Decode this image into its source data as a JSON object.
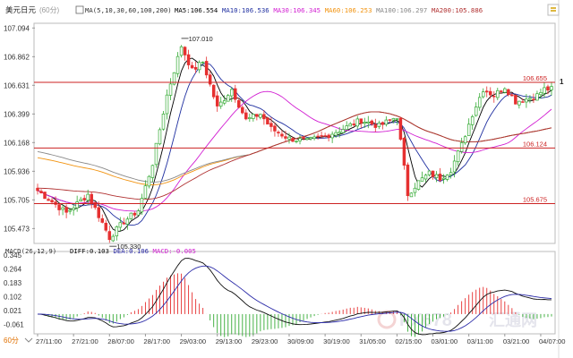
{
  "window": {
    "symbol": "美元日元",
    "period": "(60分)",
    "period_button": "60分",
    "side_marker": "1"
  },
  "watermark": {
    "text": "FX678",
    "cn": "汇通网"
  },
  "colors": {
    "up": "#33aa33",
    "down": "#e63030",
    "ma5": "#000000",
    "ma10": "#1f2fa0",
    "ma30": "#d21fd2",
    "ma60": "#f2930f",
    "ma100": "#888888",
    "ma200": "#b03030",
    "hline": "#cc2222",
    "dif": "#111111",
    "dea": "#2a2aa8",
    "macd_hist_pos": "#e63030",
    "macd_hist_neg": "#33aa33"
  },
  "chart_data": [
    {
      "type": "candlestick",
      "title": "美元日元(60分)",
      "legend_header": "MA(5,10,30,60,100,200)",
      "legend": [
        {
          "name": "MA5",
          "value": "106.554",
          "color_key": "ma5"
        },
        {
          "name": "MA10",
          "value": "106.536",
          "color_key": "ma10"
        },
        {
          "name": "MA30",
          "value": "106.345",
          "color_key": "ma30"
        },
        {
          "name": "MA60",
          "value": "106.253",
          "color_key": "ma60"
        },
        {
          "name": "MA100",
          "value": "106.297",
          "color_key": "ma100"
        },
        {
          "name": "MA200",
          "value": "105.886",
          "color_key": "ma200"
        }
      ],
      "ylim": [
        105.36,
        107.125
      ],
      "y_ticks": [
        "107.094",
        "106.862",
        "106.631",
        "106.399",
        "106.168",
        "105.936",
        "105.705",
        "105.473"
      ],
      "x_ticks": [
        "27/11:00",
        "27/21:00",
        "28/07:00",
        "28/17:00",
        "29/03:00",
        "29/13:00",
        "29/23:00",
        "30/09:00",
        "30/19:00",
        "31/05:00",
        "02/15:00",
        "03/01:00",
        "03/11:00",
        "03/21:00",
        "04/07:00"
      ],
      "x_tick_index": [
        0,
        10,
        20,
        30,
        40,
        50,
        60,
        70,
        80,
        90,
        100,
        110,
        120,
        130,
        140
      ],
      "horizontal_lines": [
        {
          "value": 106.655,
          "label": "106.655"
        },
        {
          "value": 106.124,
          "label": "106.124"
        },
        {
          "value": 105.675,
          "label": "105.675"
        }
      ],
      "annotations": [
        {
          "label": "107.010",
          "value": 107.01
        },
        {
          "label": "105.330",
          "value": 105.33
        }
      ],
      "close_points": [
        [
          0,
          105.78
        ],
        [
          8,
          105.6
        ],
        [
          14,
          105.75
        ],
        [
          18,
          105.52
        ],
        [
          20,
          105.4
        ],
        [
          24,
          105.53
        ],
        [
          28,
          105.62
        ],
        [
          32,
          106.0
        ],
        [
          36,
          106.55
        ],
        [
          40,
          106.95
        ],
        [
          43,
          106.75
        ],
        [
          46,
          106.82
        ],
        [
          50,
          106.45
        ],
        [
          54,
          106.6
        ],
        [
          58,
          106.35
        ],
        [
          62,
          106.4
        ],
        [
          65,
          106.28
        ],
        [
          70,
          106.2
        ],
        [
          75,
          106.18
        ],
        [
          80,
          106.22
        ],
        [
          85,
          106.28
        ],
        [
          90,
          106.35
        ],
        [
          95,
          106.3
        ],
        [
          100,
          106.38
        ],
        [
          101,
          106.18
        ],
        [
          103,
          105.75
        ],
        [
          106,
          105.85
        ],
        [
          109,
          105.92
        ],
        [
          112,
          105.88
        ],
        [
          115,
          105.95
        ],
        [
          118,
          106.15
        ],
        [
          121,
          106.4
        ],
        [
          124,
          106.6
        ],
        [
          127,
          106.55
        ],
        [
          130,
          106.62
        ],
        [
          133,
          106.5
        ],
        [
          136,
          106.52
        ],
        [
          139,
          106.55
        ],
        [
          141,
          106.6
        ]
      ],
      "ma_series": [
        {
          "key": "ma5",
          "period": 5
        },
        {
          "key": "ma10",
          "period": 10
        },
        {
          "key": "ma30",
          "period": 30
        },
        {
          "key": "ma60",
          "period": 60
        },
        {
          "key": "ma100",
          "period": 100
        },
        {
          "key": "ma200",
          "period": 200
        }
      ]
    },
    {
      "type": "macd",
      "title": "MACD(26,12,9)",
      "legend": [
        {
          "name": "DIFF",
          "value": "0.103",
          "color_key": "dif"
        },
        {
          "name": "DEA",
          "value": "0.106",
          "color_key": "dea"
        },
        {
          "name": "MACD",
          "value": "-0.005",
          "color_key": "ma30"
        }
      ],
      "ylim": [
        -0.11,
        0.36
      ],
      "y_ticks": [
        "0.345",
        "0.264",
        "0.183",
        "0.102",
        "0.021",
        "-0.061"
      ]
    }
  ]
}
